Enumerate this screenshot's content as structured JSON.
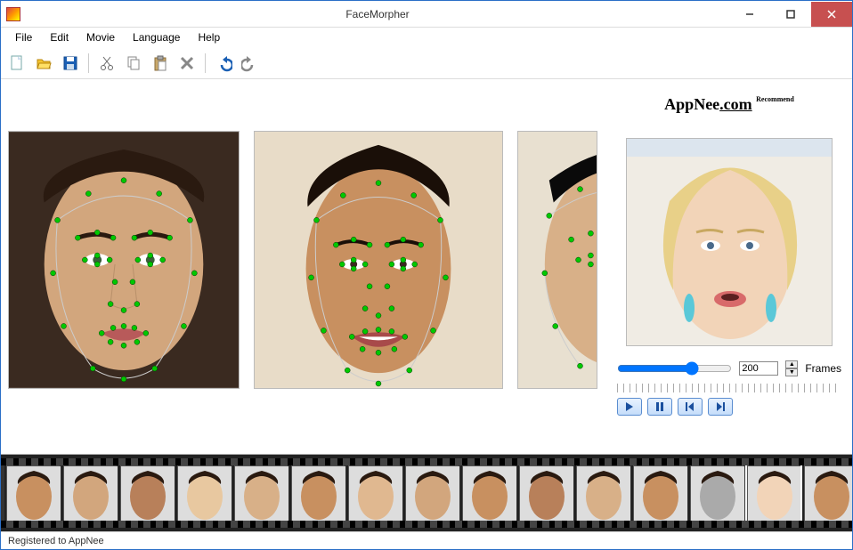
{
  "window": {
    "title": "FaceMorpher"
  },
  "menubar": [
    "File",
    "Edit",
    "Movie",
    "Language",
    "Help"
  ],
  "toolbar": {
    "new_icon": "new-file-icon",
    "open_icon": "open-folder-icon",
    "save_icon": "save-disk-icon",
    "cut_icon": "scissors-icon",
    "copy_icon": "copy-icon",
    "paste_icon": "paste-icon",
    "delete_icon": "delete-x-icon",
    "undo_icon": "undo-icon",
    "redo_icon": "redo-icon"
  },
  "sidebar": {
    "logo_text_1": "AppNee",
    "logo_text_2": ".com",
    "logo_tag": "Recommend",
    "frames_value": "200",
    "frames_label": "Frames"
  },
  "playback": {
    "play": "play-icon",
    "pause": "pause-icon",
    "prev": "skip-start-icon",
    "next": "skip-end-icon"
  },
  "filmstrip": {
    "count": 15,
    "selected_index": 13
  },
  "statusbar": {
    "text": "Registered to AppNee"
  },
  "colors": {
    "accent": "#2a6fc7",
    "landmark": "#00c800"
  }
}
